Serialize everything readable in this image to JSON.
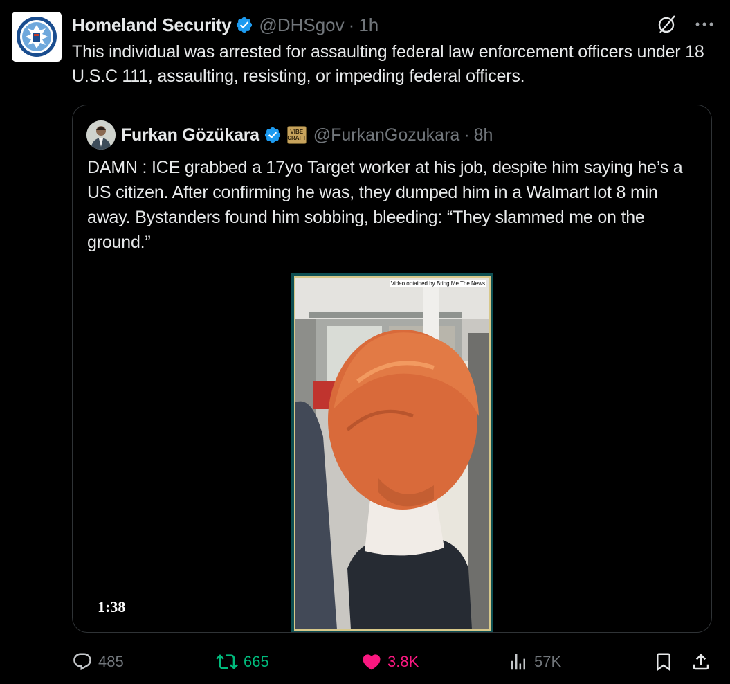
{
  "tweet": {
    "author_name": "Homeland Security",
    "handle": "@DHSgov",
    "separator": "·",
    "time": "1h",
    "text": "This individual was arrested for assaulting federal law enforcement officers under 18 U.S.C 111, assaulting, resisting, or impeding federal officers.",
    "avatar_icon": "dhs-seal-icon",
    "verified_icon": "verified-badge-icon",
    "top_actions": [
      "grok-icon",
      "more-icon"
    ]
  },
  "quote": {
    "author_name": "Furkan Gözükara",
    "affiliate_badge_lines": [
      "VIBE",
      "CRAFT"
    ],
    "handle": "@FurkanGozukara",
    "separator": "·",
    "time": "8h",
    "text": "DAMN : ICE grabbed a 17yo Target worker at his job, despite him saying he’s a US citizen. After confirming he was, they dumped him in a Walmart lot 8 min away. Bystanders found him sobbing, bleeding: “They slammed me on the ground.”",
    "video": {
      "watermark": "Video obtained by Bring Me The News",
      "duration": "1:38"
    }
  },
  "actions": {
    "replies": "485",
    "reposts": "665",
    "likes": "3.8K",
    "views": "57K",
    "icons": [
      "reply-icon",
      "repost-icon",
      "like-icon",
      "views-icon",
      "bookmark-icon",
      "share-icon"
    ]
  },
  "colors": {
    "background": "#000000",
    "text": "#e7e9ea",
    "muted": "#71767b",
    "verified": "#1d9bf0",
    "repost": "#00ba7c",
    "like": "#f91880",
    "border": "#2f3336"
  }
}
